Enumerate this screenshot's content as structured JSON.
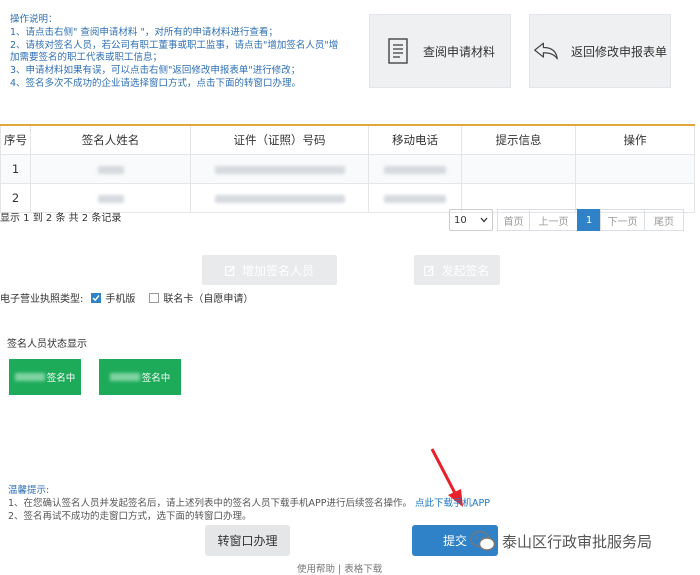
{
  "instructions": {
    "title": "操作说明：",
    "lines": [
      "1、请点击右侧\" 查阅申请材料 \"，对所有的申请材料进行查看；",
      "2、请核对签名人员，若公司有职工董事或职工监事，请点击\"增加签名人员\"增",
      "加需要签名的职工代表或职工信息；",
      "3、申请材料如果有误，可以点击右侧\"返回修改申报表单\"进行修改；",
      "4、签名多次不成功的企业请选择窗口方式，点击下面的转窗口办理。"
    ]
  },
  "buttons": {
    "view_materials": "查阅申请材料",
    "back_modify": "返回修改申报表单",
    "add_signer": "增加签名人员",
    "start_sign": "发起签名",
    "transfer": "转窗口办理",
    "submit": "提交"
  },
  "table": {
    "headers": [
      "序号",
      "签名人姓名",
      "证件（证照）号码",
      "移动电话",
      "提示信息",
      "操作"
    ],
    "rows": [
      {
        "index": "1"
      },
      {
        "index": "2"
      }
    ]
  },
  "records": "显示 1 到 2 条 共 2 条记录",
  "pagination": {
    "page_size": "10",
    "first": "首页",
    "prev": "上一页",
    "current": "1",
    "next": "下一页",
    "last": "尾页"
  },
  "license": {
    "label": "电子营业执照类型:",
    "option_phone": "手机版",
    "option_card": "联名卡（自愿申请）"
  },
  "status": {
    "title": "签名人员状态显示",
    "card1": "签名中",
    "card2": "签名中"
  },
  "tips": {
    "title": "温馨提示:",
    "line1": "1、在您确认签名人员并发起签名后，请上述列表中的签名人员下载手机APP进行后续签名操作。",
    "link": "点此下载手机APP",
    "line2": "2、签名再试不成功的走窗口方式，选下面的转窗口办理。"
  },
  "footer": {
    "help": "使用帮助",
    "sep": "|",
    "download": "表格下载"
  },
  "watermark": "泰山区行政审批服务局",
  "colors": {
    "accent_blue": "#2f82c8",
    "green": "#1dab5a",
    "header_border": "#e5a73a",
    "instruction_text": "#2f6fb5"
  }
}
